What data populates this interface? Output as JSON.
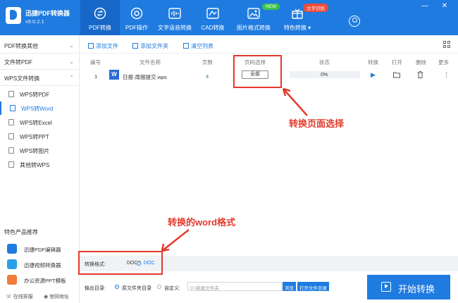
{
  "app": {
    "name": "迅捷PDF转换器",
    "version": "v9.0.2.1"
  },
  "nav": [
    {
      "label": "PDF转换",
      "icon": "convert-icon"
    },
    {
      "label": "PDF操作",
      "icon": "settings-icon"
    },
    {
      "label": "文字语音转换",
      "icon": "audio-icon"
    },
    {
      "label": "CAD转换",
      "icon": "cad-icon"
    },
    {
      "label": "图片格式转换",
      "icon": "image-icon"
    },
    {
      "label": "特色转换 ▾",
      "icon": "gift-icon"
    }
  ],
  "badges": {
    "new": "NEW",
    "feature": "文字识别"
  },
  "window_controls": {
    "minimize": "—",
    "close": "✕"
  },
  "sidebar": {
    "categories": [
      {
        "label": "PDF转换其他"
      },
      {
        "label": "文件转PDF"
      },
      {
        "label": "WPS文件转换"
      }
    ],
    "items": [
      {
        "label": "WPS转PDF"
      },
      {
        "label": "WPS转Word"
      },
      {
        "label": "WPS转Excel"
      },
      {
        "label": "WPS转PPT"
      },
      {
        "label": "WPS转图片"
      },
      {
        "label": "其他转WPS"
      }
    ],
    "section_title": "特色产品推荐",
    "products": [
      {
        "label": "迅捷PDF编辑器"
      },
      {
        "label": "迅捷视频转换器"
      },
      {
        "label": "办公资源PPT模板"
      }
    ],
    "footer": {
      "service": "在线客服",
      "website": "官网地址"
    }
  },
  "toolbar": {
    "add_file": "添加文件",
    "add_folder": "添加文件夹",
    "clear_list": "清空列表"
  },
  "table": {
    "headers": [
      "编号",
      "文件名称",
      "页数",
      "页码选择",
      "状态",
      "转换",
      "打开",
      "删除",
      "更多"
    ],
    "rows": [
      {
        "index": "1",
        "name": "日报-周报提交.wps",
        "pages": "4",
        "page_select": "全部",
        "progress": "0%"
      }
    ]
  },
  "annotations": {
    "page_select_note": "转换页面选择",
    "format_note": "转换的word格式"
  },
  "format": {
    "label": "转换格式:",
    "options": [
      "DOCX",
      "DOC"
    ],
    "selected": "DOC"
  },
  "output": {
    "label": "输出目录:",
    "source_dir": "原文件夹目录",
    "custom": "自定义:",
    "path": "D:\\新建文件夹",
    "browse": "浏览",
    "open_folder": "打开文件目录"
  },
  "start_button": "开始转换",
  "colors": {
    "primary": "#1f7be0",
    "annotation": "#e33a2c"
  }
}
